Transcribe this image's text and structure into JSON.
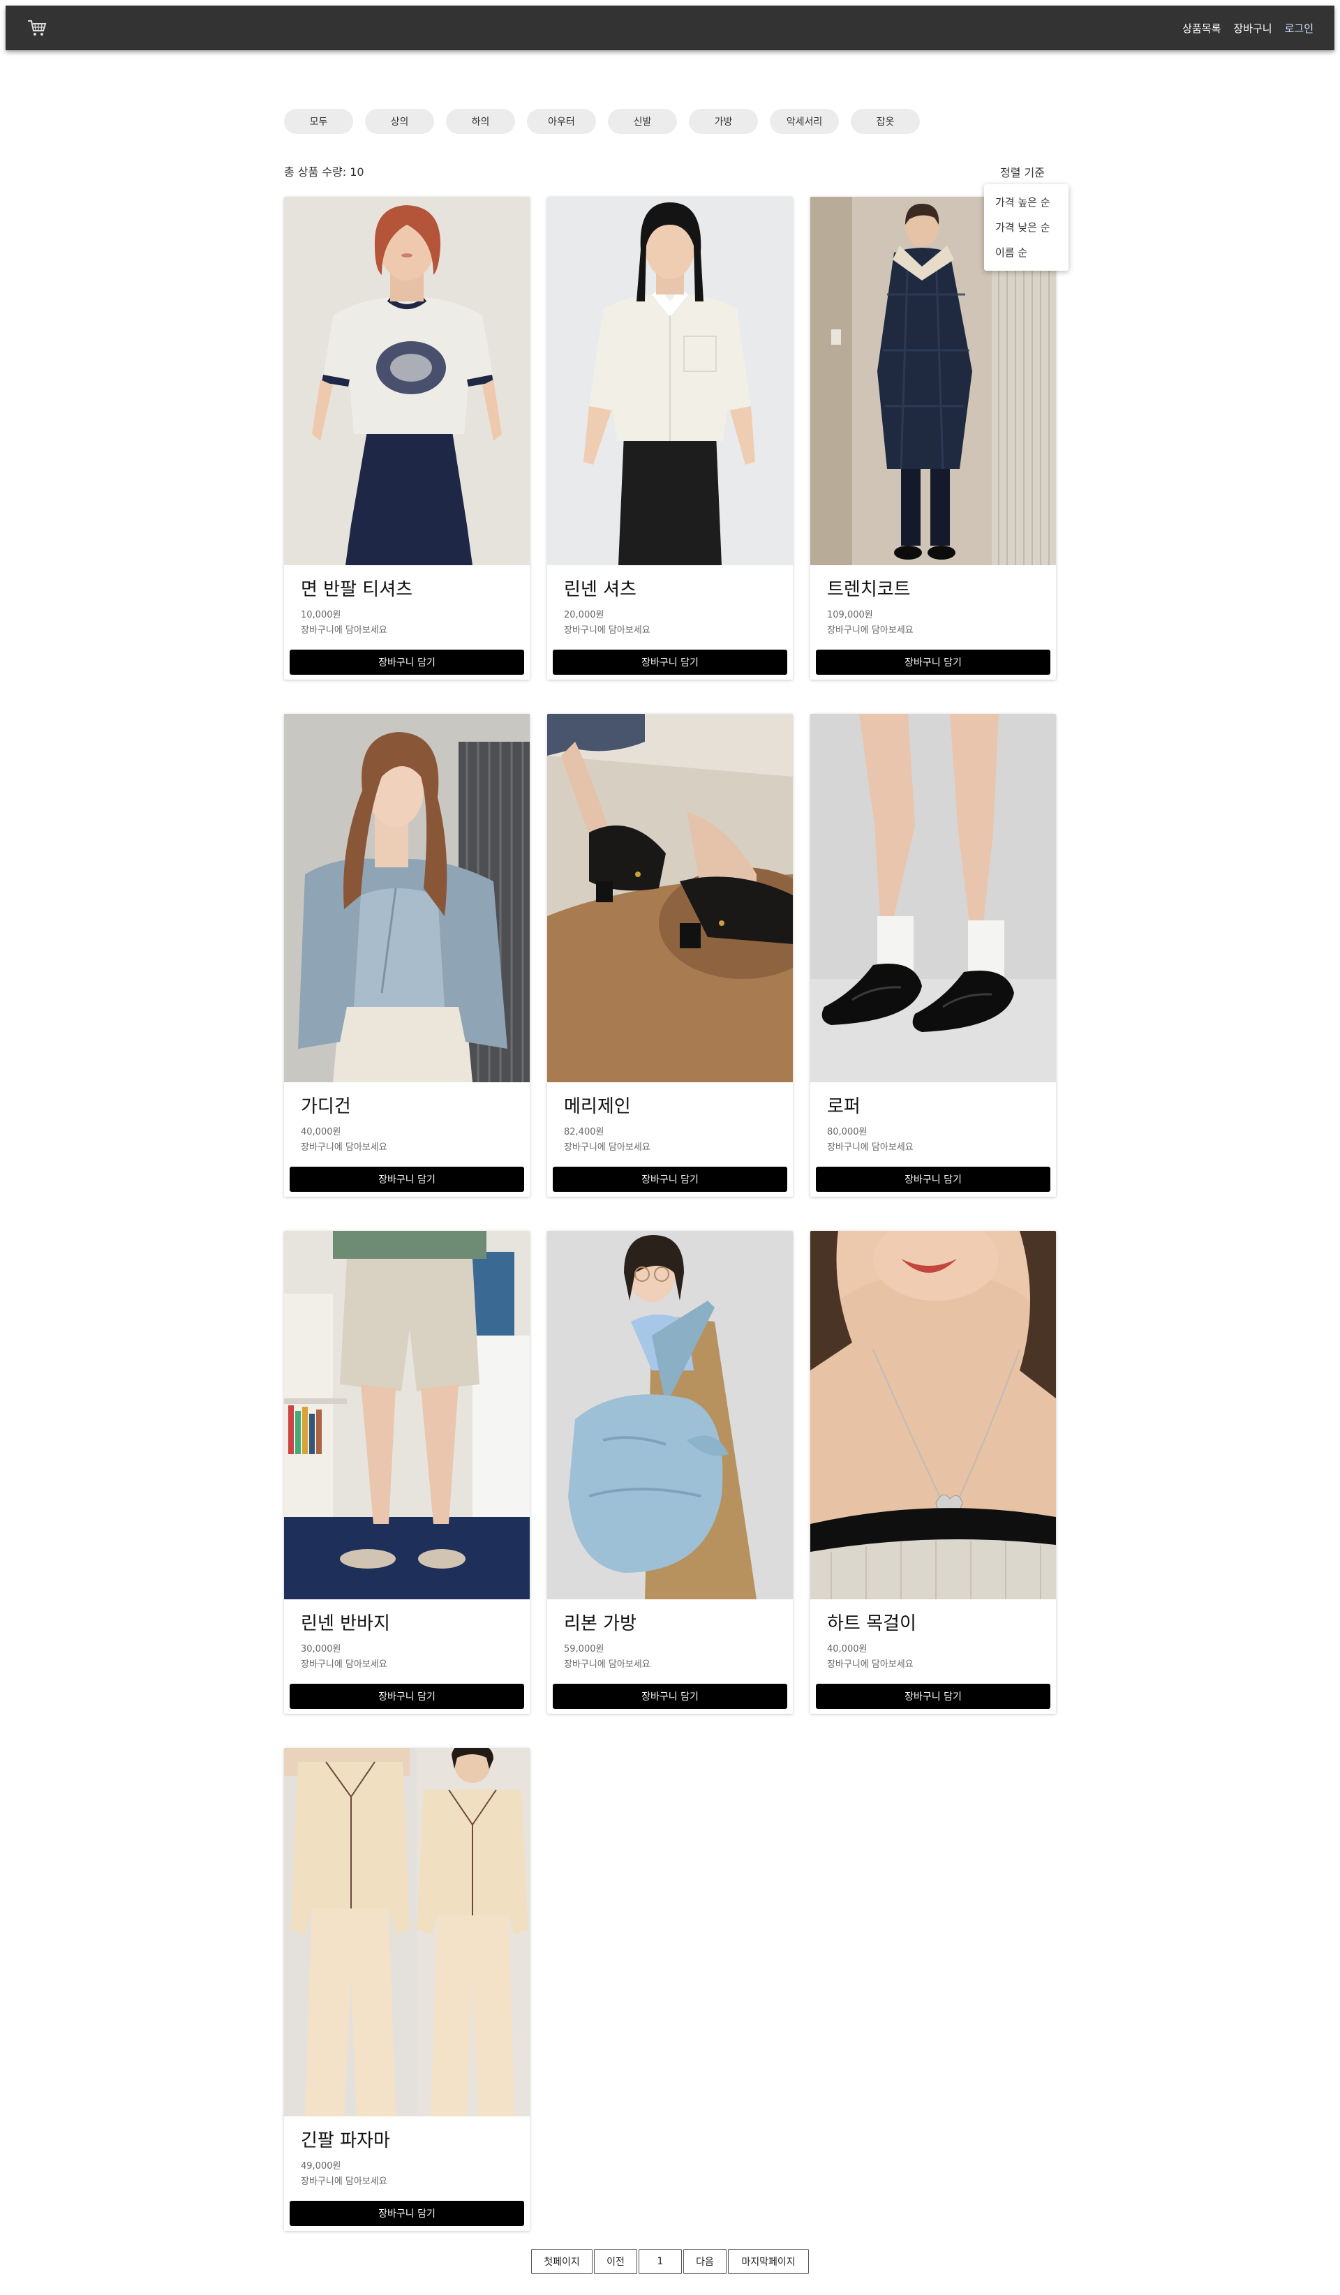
{
  "header": {
    "logo_icon": "shopping-cart-icon",
    "nav": {
      "products": "상품목록",
      "cart": "장바구니",
      "login": "로그인"
    }
  },
  "categories": [
    "모두",
    "상의",
    "하의",
    "아우터",
    "신발",
    "가방",
    "악세서리",
    "잡옷"
  ],
  "toolbar": {
    "count_label": "총 상품 수량: 10",
    "sort_label": "정렬 기준",
    "sort_options": [
      "가격 높은 순",
      "가격 낮은 순",
      "이름 순"
    ]
  },
  "products": [
    {
      "name": "면 반팔 티셔츠",
      "price": "10,000원",
      "hint": "장바구니에 담아보세요",
      "button": "장바구니 담기"
    },
    {
      "name": "린넨 셔츠",
      "price": "20,000원",
      "hint": "장바구니에 담아보세요",
      "button": "장바구니 담기"
    },
    {
      "name": "트렌치코트",
      "price": "109,000원",
      "hint": "장바구니에 담아보세요",
      "button": "장바구니 담기"
    },
    {
      "name": "가디건",
      "price": "40,000원",
      "hint": "장바구니에 담아보세요",
      "button": "장바구니 담기"
    },
    {
      "name": "메리제인",
      "price": "82,400원",
      "hint": "장바구니에 담아보세요",
      "button": "장바구니 담기"
    },
    {
      "name": "로퍼",
      "price": "80,000원",
      "hint": "장바구니에 담아보세요",
      "button": "장바구니 담기"
    },
    {
      "name": "린넨 반바지",
      "price": "30,000원",
      "hint": "장바구니에 담아보세요",
      "button": "장바구니 담기"
    },
    {
      "name": "리본 가방",
      "price": "59,000원",
      "hint": "장바구니에 담아보세요",
      "button": "장바구니 담기"
    },
    {
      "name": "하트 목걸이",
      "price": "40,000원",
      "hint": "장바구니에 담아보세요",
      "button": "장바구니 담기"
    },
    {
      "name": "긴팔 파자마",
      "price": "49,000원",
      "hint": "장바구니에 담아보세요",
      "button": "장바구니 담기"
    }
  ],
  "pagination": {
    "first": "첫페이지",
    "prev": "이전",
    "current": "1",
    "next": "다음",
    "last": "마지막페이지"
  },
  "colors": {
    "header_bg": "#333333",
    "button_bg": "#000000",
    "chip_bg": "#ececec"
  }
}
